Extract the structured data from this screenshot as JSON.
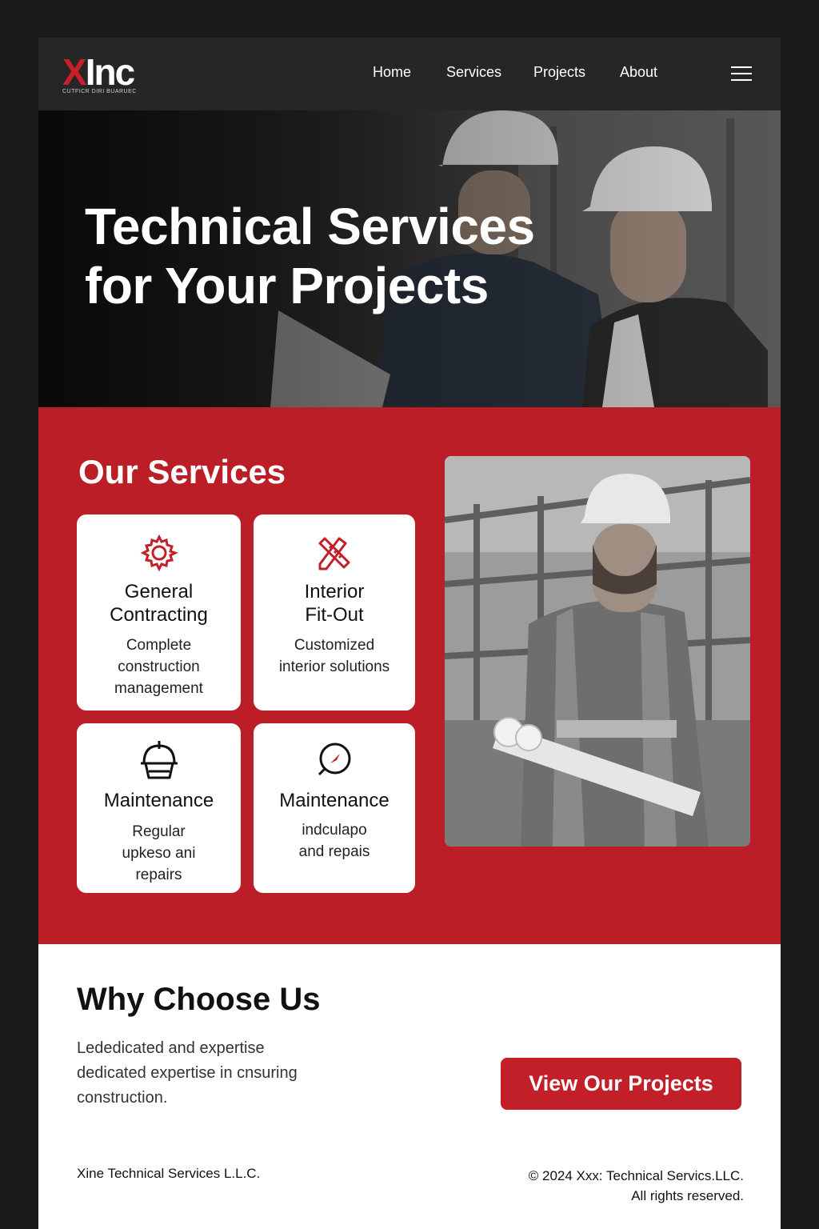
{
  "brand": {
    "logo_x": "X",
    "logo_rest": "Inc",
    "tagline": "CUTFICR DIRI BUARUEC"
  },
  "nav": {
    "items": [
      "Home",
      "Services",
      "Projects",
      "About"
    ],
    "menu_icon": "hamburger-icon"
  },
  "hero": {
    "title_line1": "Technical Services",
    "title_line2": "for Your Projects"
  },
  "services": {
    "title": "Our Services",
    "cards": [
      {
        "icon": "gear-icon",
        "title_line1": "General",
        "title_line2": "Contracting",
        "desc_line1": "Complete",
        "desc_line2": "construction",
        "desc_line3": "management"
      },
      {
        "icon": "pencil-ruler-icon",
        "title_line1": "Interior",
        "title_line2": "Fit-Out",
        "desc_line1": "Customized",
        "desc_line2": "interior solutions",
        "desc_line3": ""
      },
      {
        "icon": "hard-hat-icon",
        "title_line1": "Maintenance",
        "title_line2": "",
        "desc_line1": "Regular",
        "desc_line2": "upkeso ani",
        "desc_line3": "repairs"
      },
      {
        "icon": "compass-icon",
        "title_line1": "Maintenance",
        "title_line2": "",
        "desc_line1": "indculapo",
        "desc_line2": "and repais",
        "desc_line3": ""
      }
    ]
  },
  "why": {
    "title": "Why Choose Us",
    "text_line1": "Lededicated and expertise",
    "text_line2": "dedicated expertise in cnsuring",
    "text_line3": "construction.",
    "cta": "View Our Projects"
  },
  "footer": {
    "company": "Xine Technical Services L.L.C.",
    "copyright_line1": "© 2024 Xxx: Technical Servics.LLC.",
    "copyright_line2": "All rights reserved."
  },
  "colors": {
    "brand_red": "#c21f28",
    "nav_bg": "#262626",
    "page_bg": "#1a1a1a"
  }
}
